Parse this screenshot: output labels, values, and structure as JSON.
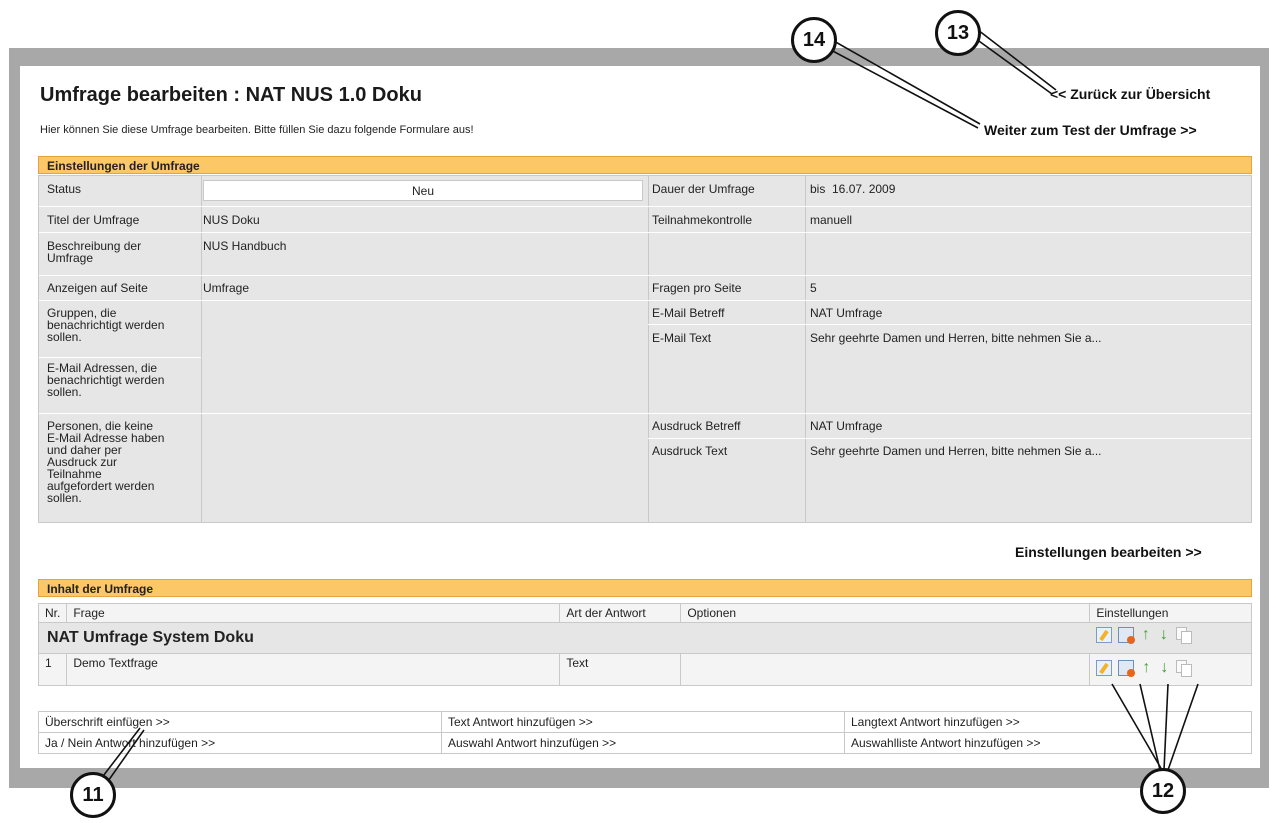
{
  "header": {
    "title": "Umfrage bearbeiten : NAT NUS 1.0 Doku",
    "intro": "Hier können Sie diese Umfrage bearbeiten. Bitte füllen Sie dazu folgende Formulare aus!",
    "back_link": "<< Zurück zur Übersicht",
    "test_link": "Weiter zum Test der Umfrage >>"
  },
  "settings": {
    "section_title": "Einstellungen der Umfrage",
    "status_label": "Status",
    "status_value": "Neu",
    "duration_label": "Dauer der Umfrage",
    "duration_value": "bis  16.07. 2009",
    "title_label": "Titel der Umfrage",
    "title_value": "NUS Doku",
    "control_label": "Teilnahmekontrolle",
    "control_value": "manuell",
    "description_label": "Beschreibung der Umfrage",
    "description_value": "NUS Handbuch",
    "display_label": "Anzeigen auf Seite",
    "display_value": "Umfrage",
    "per_page_label": "Fragen pro Seite",
    "per_page_value": "5",
    "groups_label": "Gruppen, die benachrichtigt werden sollen.",
    "email_addresses_label": "E-Mail Adressen, die benachrichtigt werden sollen.",
    "persons_label": "Personen, die keine E-Mail Adresse haben und daher per Ausdruck zur Teilnahme aufgefordert werden sollen.",
    "email_subject_label": "E-Mail Betreff",
    "email_subject_value": "NAT Umfrage",
    "email_text_label": "E-Mail Text",
    "email_text_value": "Sehr geehrte Damen und Herren, bitte nehmen Sie a...",
    "print_subject_label": "Ausdruck Betreff",
    "print_subject_value": "NAT Umfrage",
    "print_text_label": "Ausdruck Text",
    "print_text_value": "Sehr geehrte Damen und Herren, bitte nehmen Sie a...",
    "edit_link": "Einstellungen bearbeiten >>"
  },
  "content": {
    "section_title": "Inhalt der Umfrage",
    "columns": {
      "nr": "Nr.",
      "question": "Frage",
      "answer_type": "Art der Antwort",
      "options": "Optionen",
      "settings": "Einstellungen"
    },
    "heading_row": "NAT Umfrage System Doku",
    "rows": [
      {
        "nr": "1",
        "question": "Demo Textfrage",
        "answer_type": "Text",
        "options": ""
      }
    ]
  },
  "add_actions": {
    "insert_heading": "Überschrift einfügen >>",
    "add_text": "Text Antwort hinzufügen >>",
    "add_longtext": "Langtext Antwort hinzufügen >>",
    "add_yesno": "Ja / Nein Antwort hinzufügen >>",
    "add_choice": "Auswahl Antwort hinzufügen >>",
    "add_choicelist": "Auswahlliste Antwort hinzufügen >>"
  },
  "callouts": {
    "c11": "11",
    "c12": "12",
    "c13": "13",
    "c14": "14"
  },
  "icons": [
    "edit-icon",
    "delete-icon",
    "move-up-icon",
    "move-down-icon",
    "copy-icon"
  ],
  "colors": {
    "section_header": "#fbc767",
    "frame": "#a8a8a8",
    "table_bg": "#e6e6e6"
  }
}
